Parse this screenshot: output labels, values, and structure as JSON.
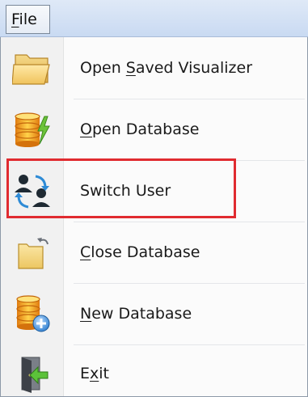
{
  "menubar": {
    "file_label": "File",
    "file_mnemonic": "F",
    "file_rest": "ile"
  },
  "menu": {
    "items": [
      {
        "pre": "Open ",
        "mnemonic": "S",
        "post": "aved Visualizer",
        "icon": "folder-open-icon"
      },
      {
        "pre": "",
        "mnemonic": "O",
        "post": "pen Database",
        "icon": "database-lightning-icon"
      },
      {
        "pre": "Switch User",
        "mnemonic": "",
        "post": "",
        "icon": "switch-user-icon"
      },
      {
        "pre": "",
        "mnemonic": "C",
        "post": "lose Database",
        "icon": "folder-close-icon"
      },
      {
        "pre": "",
        "mnemonic": "N",
        "post": "ew Database",
        "icon": "database-add-icon"
      },
      {
        "pre": "E",
        "mnemonic": "x",
        "post": "it",
        "icon": "exit-door-icon"
      }
    ]
  },
  "highlight_color": "#e02b30"
}
